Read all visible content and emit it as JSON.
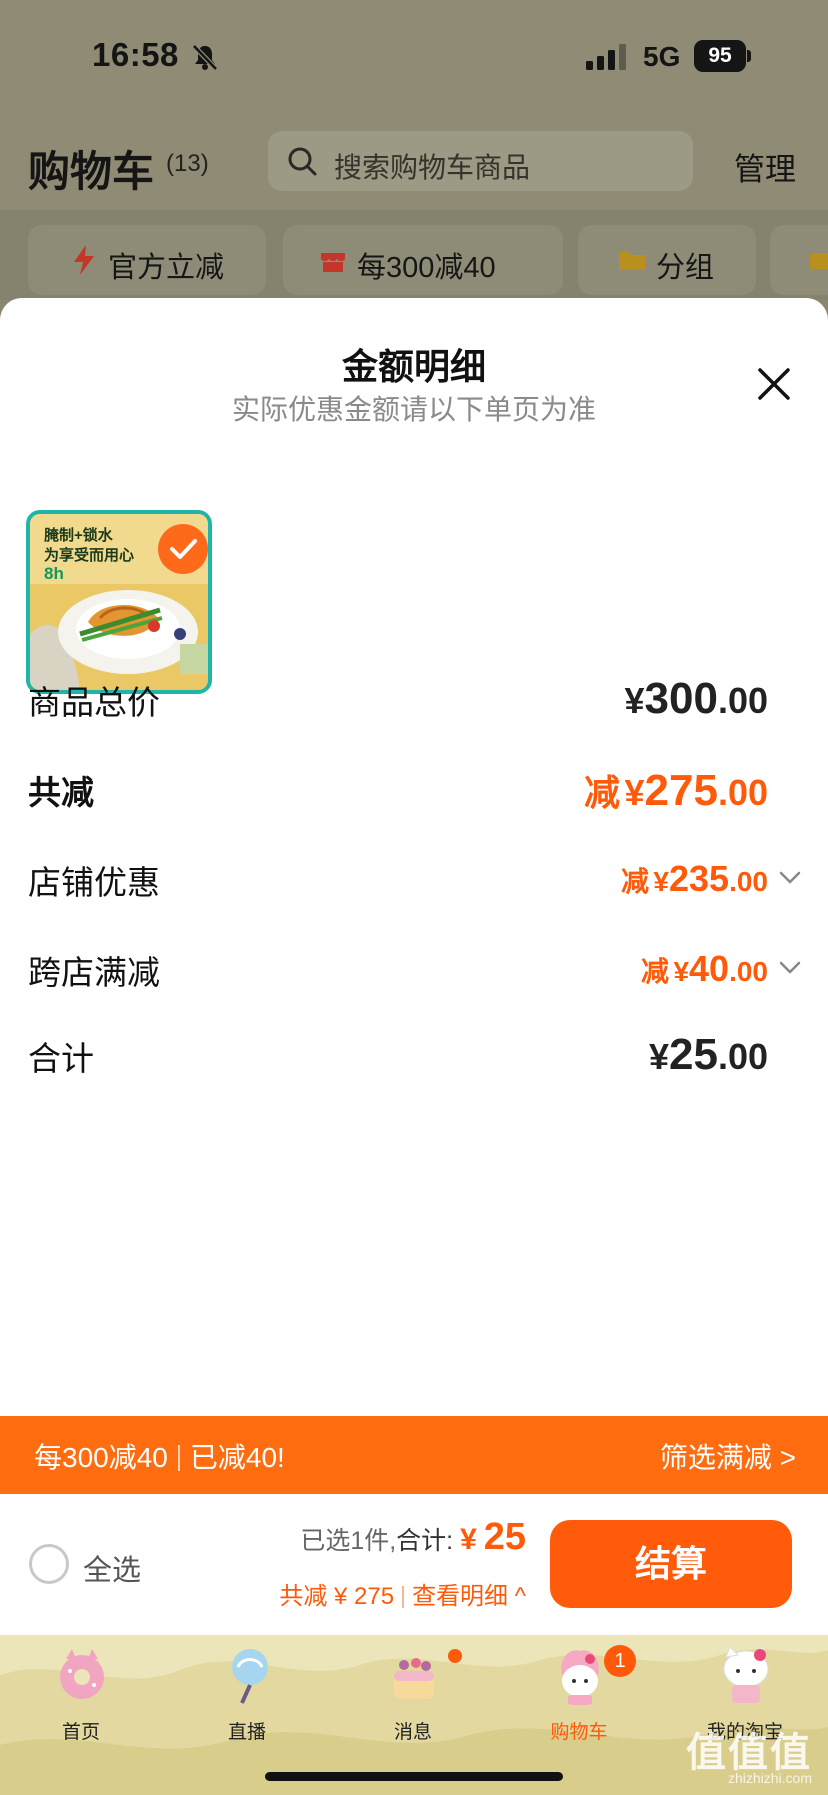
{
  "status_bar": {
    "time": "16:58",
    "network": "5G",
    "battery": "95"
  },
  "header": {
    "title": "购物车",
    "count": "(13)",
    "search_placeholder": "搜索购物车商品",
    "manage": "管理"
  },
  "filters": [
    {
      "label": "官方立减",
      "icon": "lightning-icon"
    },
    {
      "label": "每300减40",
      "icon": "shop-icon"
    },
    {
      "label": "分组",
      "icon": "folder-icon"
    }
  ],
  "sheet": {
    "title": "金额明细",
    "subtitle": "实际优惠金额请以下单页为准",
    "product": {
      "tag_line1": "腌制+锁水",
      "tag_line2": "为享受而用心",
      "badge": "8h",
      "selected": true
    },
    "rows": {
      "subtotal": {
        "label": "商品总价",
        "symbol": "¥",
        "integer": "300",
        "cents": ".00"
      },
      "discount_total": {
        "label": "共减",
        "prefix": "减",
        "symbol": "¥",
        "integer": "275",
        "cents": ".00"
      },
      "store_discount": {
        "label": "店铺优惠",
        "prefix": "减",
        "symbol": "¥",
        "integer": "235",
        "cents": ".00"
      },
      "cross_store": {
        "label": "跨店满减",
        "prefix": "减",
        "symbol": "¥",
        "integer": "40",
        "cents": ".00"
      },
      "total": {
        "label": "合计",
        "symbol": "¥",
        "integer": "25",
        "cents": ".00"
      }
    }
  },
  "promo": {
    "left": "每300减40",
    "right": "已减40!",
    "filter": "筛选满减 >"
  },
  "checkout": {
    "select_all": "全选",
    "selected_text": "已选1件,",
    "total_label": "合计:",
    "total_symbol": "¥",
    "total_amount": "25",
    "discount_text": "共减 ¥ 275",
    "detail_link": "查看明细 ^",
    "button": "结算"
  },
  "tabs": [
    {
      "label": "首页",
      "icon": "donut-icon"
    },
    {
      "label": "直播",
      "icon": "lollipop-icon"
    },
    {
      "label": "消息",
      "icon": "cake-icon",
      "dot": true
    },
    {
      "label": "购物车",
      "icon": "melody-icon",
      "badge": "1",
      "active": true
    },
    {
      "label": "我的淘宝",
      "icon": "kitty-icon"
    }
  ],
  "watermark": {
    "main": "值值值",
    "sub": "zhizhizhi.com"
  },
  "colors": {
    "accent": "#ff5a0a",
    "banner": "#ff6d10",
    "thumb_border": "#1fb5a8"
  }
}
